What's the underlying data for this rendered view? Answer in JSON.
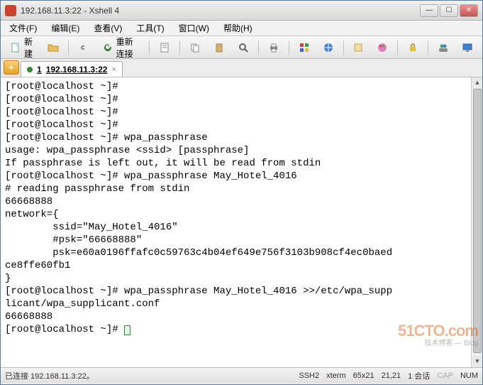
{
  "window": {
    "title": "192.168.11.3:22 - Xshell 4"
  },
  "menu": {
    "file": "文件(F)",
    "edit": "编辑(E)",
    "view": "查看(V)",
    "tools": "工具(T)",
    "window": "窗口(W)",
    "help": "帮助(H)"
  },
  "toolbar": {
    "new_label": "新建",
    "reconnect_label": "重新连接"
  },
  "tabs": {
    "add": "+",
    "active": {
      "index": "1",
      "label": "192.168.11.3:22",
      "close": "×"
    }
  },
  "terminal": {
    "lines": [
      "[root@localhost ~]#",
      "[root@localhost ~]#",
      "[root@localhost ~]#",
      "[root@localhost ~]#",
      "[root@localhost ~]# wpa_passphrase",
      "usage: wpa_passphrase <ssid> [passphrase]",
      "",
      "If passphrase is left out, it will be read from stdin",
      "[root@localhost ~]# wpa_passphrase May_Hotel_4016",
      "# reading passphrase from stdin",
      "66668888",
      "network={",
      "        ssid=\"May_Hotel_4016\"",
      "        #psk=\"66668888\"",
      "        psk=e60a0196ffafc0c59763c4b04ef649e756f3103b908cf4ec0baed",
      "ce8ffe60fb1",
      "}",
      "[root@localhost ~]# wpa_passphrase May_Hotel_4016 >>/etc/wpa_supp",
      "licant/wpa_supplicant.conf",
      "66668888",
      "[root@localhost ~]# "
    ]
  },
  "status": {
    "conn": "已连接 192.168.11.3:22。",
    "proto": "SSH2",
    "term": "xterm",
    "size": "65x21",
    "pos": "21,21",
    "sessions": "1 会话",
    "cap": "CAP",
    "num": "NUM"
  },
  "watermark": {
    "big": "51CTO.com",
    "small": "技术博客 — Blog"
  }
}
